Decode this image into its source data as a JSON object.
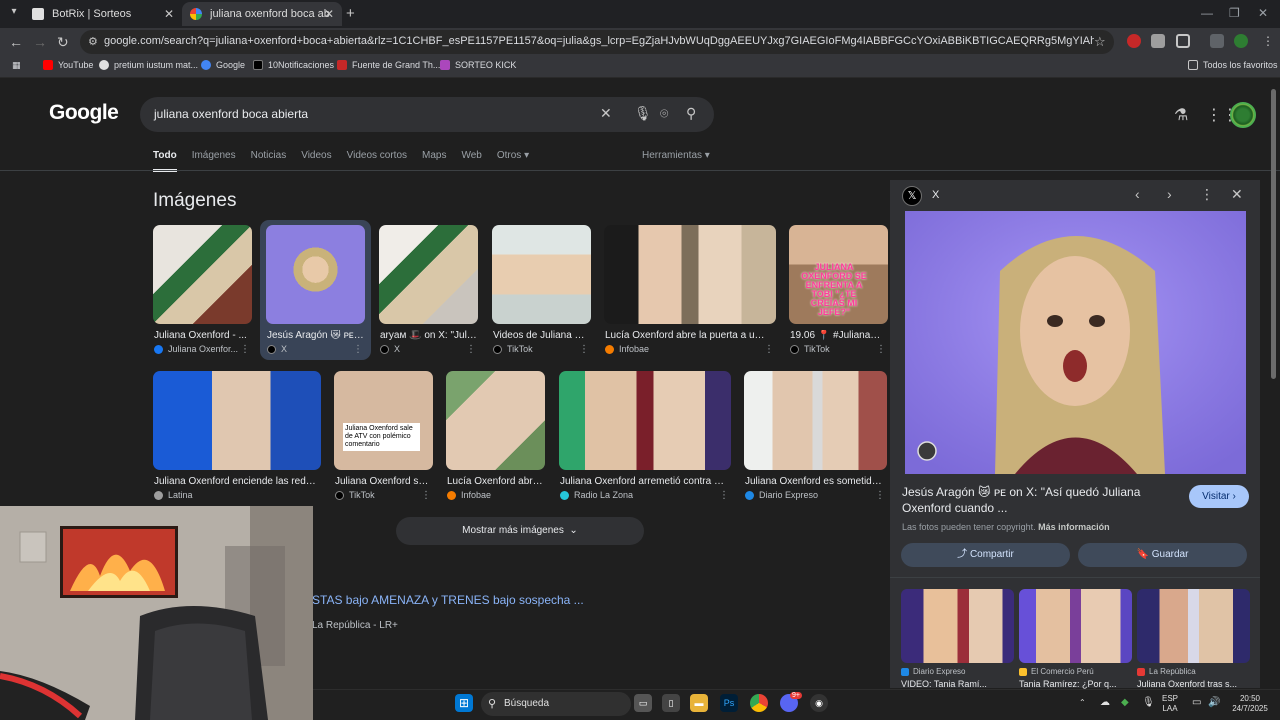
{
  "browser": {
    "tabs": [
      {
        "title": "BotRix | Sorteos",
        "active": false
      },
      {
        "title": "juliana oxenford boca abierta -",
        "active": true
      }
    ],
    "url": "google.com/search?q=juliana+oxenford+boca+abierta&rlz=1C1CHBF_esPE1157PE1157&oq=julia&gs_lcrp=EgZjaHJvbWUqDggAEEUYJxg7GIAEGIoFMg4IABBFGCcYOxiABBiKBTIGCAEQRRg5MgYIAhBFGEAyDggDEEUYJxg7GIAEGIoFMgYIBB...",
    "bookmarks": [
      {
        "label": "YouTube",
        "color": "#ff0000"
      },
      {
        "label": "pretium iustum mat...",
        "color": "#e0e0e0"
      },
      {
        "label": "Google",
        "color": "#4285f4"
      },
      {
        "label": "10Notificaciones",
        "color": "#000000"
      },
      {
        "label": "Fuente de Grand Th...",
        "color": "#c62828"
      },
      {
        "label": "SORTEO KICK",
        "color": "#ab47bc"
      }
    ],
    "all_bookmarks": "Todos los favoritos"
  },
  "google": {
    "logo": "Google",
    "query": "juliana oxenford boca abierta",
    "tabs": [
      "Todo",
      "Imágenes",
      "Noticias",
      "Videos",
      "Videos cortos",
      "Maps",
      "Web",
      "Otros"
    ],
    "tools": "Herramientas",
    "images_heading": "Imágenes",
    "images": [
      {
        "title": "Juliana Oxenford - ...",
        "source": "Juliana Oxenfor...",
        "src_color": "#1877f2"
      },
      {
        "title": "Jesús Aragón 😿 ᴘᴇ o...",
        "source": "X",
        "src_color": "#000000"
      },
      {
        "title": "aryaм 🎩 on X: \"Juli...",
        "source": "X",
        "src_color": "#000000"
      },
      {
        "title": "Videos de Juliana Ox...",
        "source": "TikTok",
        "src_color": "#000000"
      },
      {
        "title": "Lucía Oxenford abre la puerta a una r...",
        "source": "Infobae",
        "src_color": "#f57c00"
      },
      {
        "title": "19.06 📍 #JulianaOx...",
        "source": "TikTok",
        "src_color": "#000000"
      },
      {
        "title": "Juliana Oxenford enciende las redes ...",
        "source": "Latina",
        "src_color": "#9e9e9e"
      },
      {
        "title": "Juliana Oxenford se ...",
        "source": "TikTok",
        "src_color": "#000000"
      },
      {
        "title": "Lucía Oxenford abre ...",
        "source": "Infobae",
        "src_color": "#f57c00"
      },
      {
        "title": "Juliana Oxenford arremetió contra Fio...",
        "source": "Radio La Zona",
        "src_color": "#26c6da"
      },
      {
        "title": "Juliana Oxenford es sometida a...",
        "source": "Diario Expreso",
        "src_color": "#1e88e5"
      }
    ],
    "overlay_text_tiktok": "JULIANA OXENFORD SE ENFRENTA A TOBI \"¿TE CREÍAS MI JEFE?\"",
    "overlay_text_atv": "Juliana Oxenford sale de ATV con polémico comentario",
    "more_images": "Mostrar más imágenes",
    "result_link": "STAS bajo AMENAZA y TRENES bajo sospecha ...",
    "result_source": "La República - LR+"
  },
  "panel": {
    "source": "X",
    "title": "Jesús Aragón 😿 ᴘᴇ on X: \"Así quedó Juliana Oxenford cuando ...",
    "visit": "Visitar",
    "copyright": "Las fotos pueden tener copyright.",
    "more_info": "Más información",
    "share": "Compartir",
    "save": "Guardar",
    "related": [
      {
        "source": "Diario Expreso",
        "title": "VIDEO: Tania Ramí...",
        "color": "#1e88e5"
      },
      {
        "source": "El Comercio Perú",
        "title": "Tania Ramírez: ¿Por q...",
        "color": "#fbc02d"
      },
      {
        "source": "La República",
        "title": "Juliana Oxenford tras s...",
        "color": "#e53935"
      }
    ]
  },
  "taskbar": {
    "search": "Búsqueda",
    "lang": "ESP",
    "lang2": "LAA",
    "time": "20:50",
    "date": "24/7/2025",
    "discord_badge": "9+"
  }
}
